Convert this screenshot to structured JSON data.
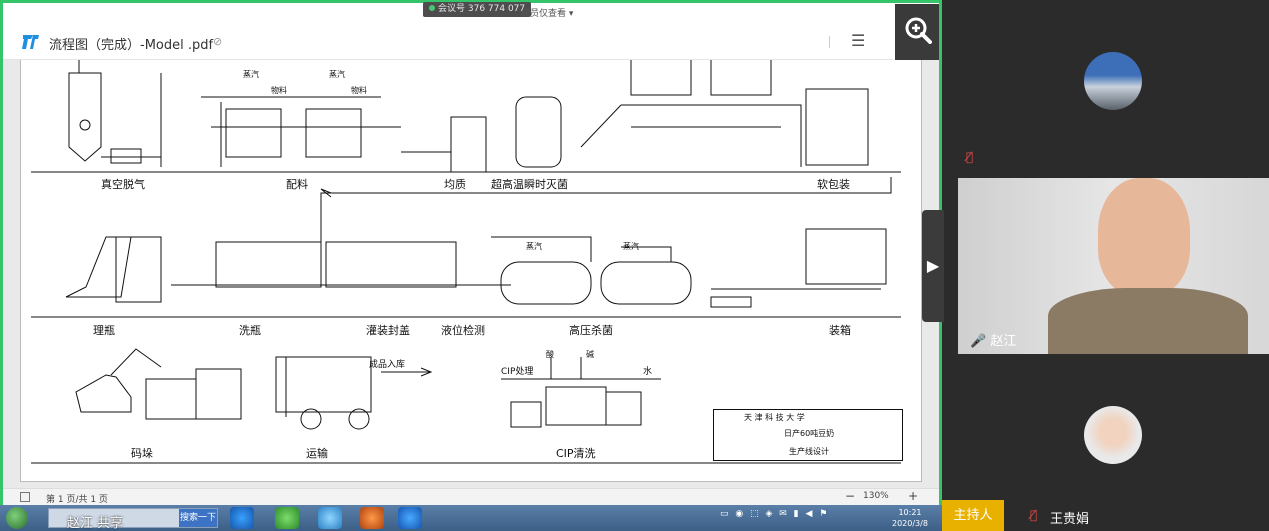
{
  "meeting": {
    "id_badge": "会议号 376 774 077",
    "viewer_note": "成员仅查看 ▾"
  },
  "pdf": {
    "title": "流程图（完成）-Model .pdf",
    "menu_icon": "hamburger-icon",
    "zoom_icon": "zoom-in-icon"
  },
  "diagram": {
    "row1": [
      "真空脱气",
      "配料",
      "均质",
      "超高温瞬时灭菌",
      "软包装"
    ],
    "row2": [
      "理瓶",
      "洗瓶",
      "灌装封盖",
      "液位检测",
      "高压杀菌",
      "装箱"
    ],
    "row3": [
      "码垛",
      "运输",
      "CIP清洗"
    ],
    "annotations": {
      "steam1": "蒸汽",
      "steam2": "蒸汽",
      "feed1": "物料",
      "feed2": "物料",
      "steam3": "蒸汽",
      "steam4": "蒸汽",
      "warehouse": "成品入库",
      "cip": "CIP处理",
      "acid": "酸",
      "alkali": "碱",
      "water": "水"
    },
    "title_block": {
      "school": "天 津 科 技 大 学",
      "project": "日产60吨豆奶",
      "subtitle": "生产线设计"
    }
  },
  "status": {
    "page": "第 1 页/共 1 页",
    "zoom": "130%",
    "minus": "−",
    "plus": "+"
  },
  "taskbar": {
    "search_text": "赵江 共享",
    "search_button": "搜索一下",
    "clock_time": "10:21",
    "clock_date": "2020/3/8"
  },
  "participants": [
    {
      "name": "",
      "muted": true
    },
    {
      "name": "赵江",
      "muted": false
    },
    {
      "name": "王贵娟",
      "muted": true,
      "role": "主持人"
    }
  ],
  "colors": {
    "share_border": "#35c46a",
    "host_badge": "#e8b100",
    "panel_bg": "#2b2b2b"
  }
}
